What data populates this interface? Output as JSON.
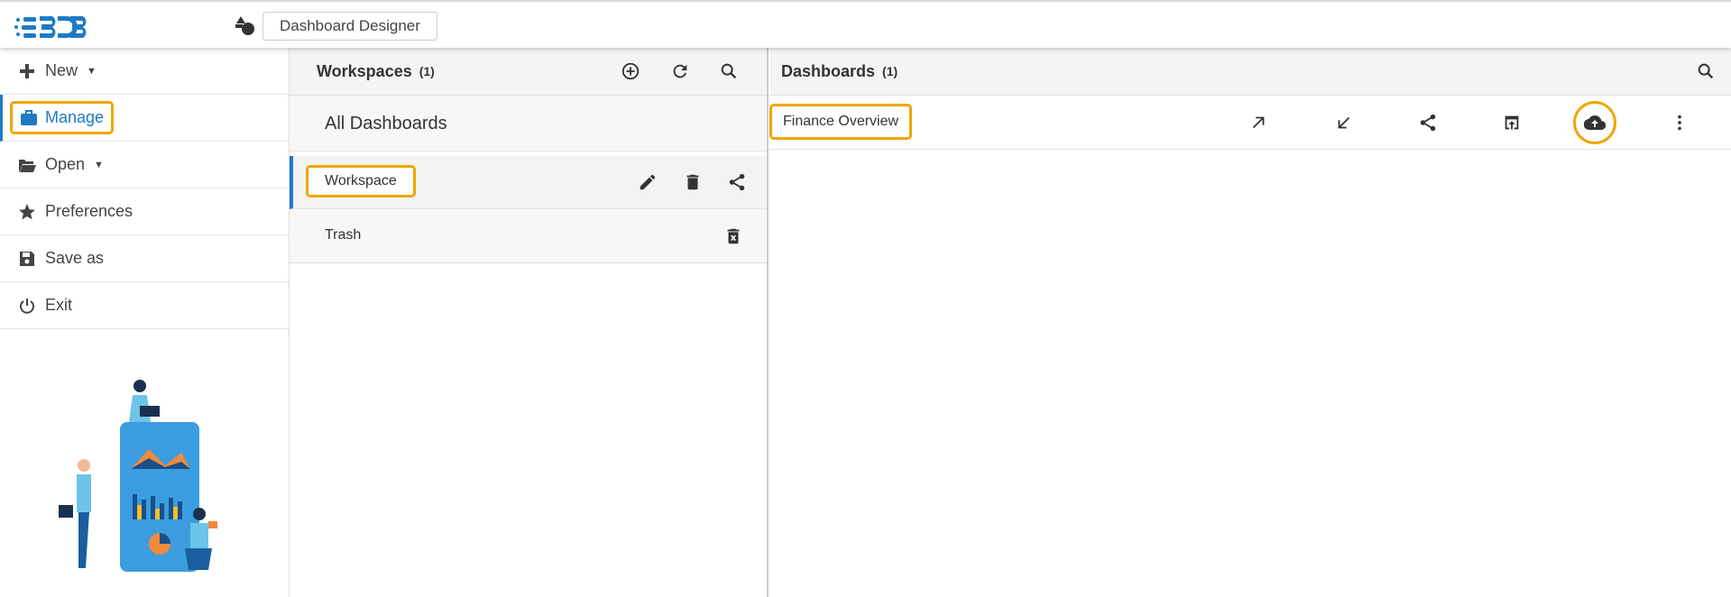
{
  "header": {
    "logo_text": "BDB",
    "app_button": "Dashboard Designer"
  },
  "sidebar": {
    "items": [
      {
        "label": "New",
        "icon": "plus-icon"
      },
      {
        "label": "Manage",
        "icon": "briefcase-icon"
      },
      {
        "label": "Open",
        "icon": "folder-open-icon"
      },
      {
        "label": "Preferences",
        "icon": "star-icon"
      },
      {
        "label": "Save as",
        "icon": "save-icon"
      },
      {
        "label": "Exit",
        "icon": "power-icon"
      }
    ]
  },
  "workspaces": {
    "title": "Workspaces",
    "count": "(1)",
    "all_dashboards": "All Dashboards",
    "items": [
      {
        "label": "Workspace"
      },
      {
        "label": "Trash"
      }
    ]
  },
  "dashboards": {
    "title": "Dashboards",
    "count": "(1)",
    "items": [
      {
        "label": "Finance Overview"
      }
    ]
  },
  "colors": {
    "accent": "#f0a500",
    "brand": "#1f7ac3"
  }
}
